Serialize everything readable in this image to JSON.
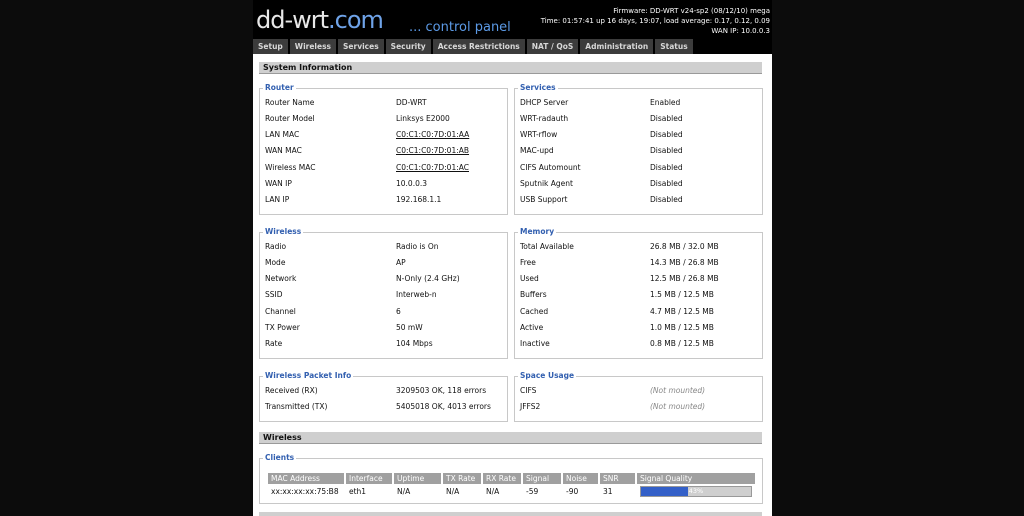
{
  "header": {
    "logo_main": "dd-wrt",
    "logo_suffix": ".com",
    "tagline": "... control panel",
    "firmware": "Firmware: DD-WRT v24-sp2 (08/12/10) mega",
    "time": "Time: 01:57:41 up 16 days, 19:07, load average: 0.17, 0.12, 0.09",
    "wan_ip": "WAN IP: 10.0.0.3"
  },
  "nav": [
    "Setup",
    "Wireless",
    "Services",
    "Security",
    "Access Restrictions",
    "NAT / QoS",
    "Administration",
    "Status"
  ],
  "section1_title": "System Information",
  "router": {
    "title": "Router",
    "rows": [
      {
        "k": "Router Name",
        "v": "DD-WRT"
      },
      {
        "k": "Router Model",
        "v": "Linksys E2000"
      },
      {
        "k": "LAN MAC",
        "v": "C0:C1:C0:7D:01:AA"
      },
      {
        "k": "WAN MAC",
        "v": "C0:C1:C0:7D:01:AB"
      },
      {
        "k": "Wireless MAC",
        "v": "C0:C1:C0:7D:01:AC"
      },
      {
        "k": "WAN IP",
        "v": "10.0.0.3"
      },
      {
        "k": "LAN IP",
        "v": "192.168.1.1"
      }
    ]
  },
  "services": {
    "title": "Services",
    "rows": [
      {
        "k": "DHCP Server",
        "v": "Enabled"
      },
      {
        "k": "WRT-radauth",
        "v": "Disabled"
      },
      {
        "k": "WRT-rflow",
        "v": "Disabled"
      },
      {
        "k": "MAC-upd",
        "v": "Disabled"
      },
      {
        "k": "CIFS Automount",
        "v": "Disabled"
      },
      {
        "k": "Sputnik Agent",
        "v": "Disabled"
      },
      {
        "k": "USB Support",
        "v": "Disabled"
      }
    ]
  },
  "wireless": {
    "title": "Wireless",
    "rows": [
      {
        "k": "Radio",
        "v": "Radio is On"
      },
      {
        "k": "Mode",
        "v": "AP"
      },
      {
        "k": "Network",
        "v": "N-Only (2.4 GHz)"
      },
      {
        "k": "SSID",
        "v": "Interweb-n"
      },
      {
        "k": "Channel",
        "v": "6"
      },
      {
        "k": "TX Power",
        "v": "50 mW"
      },
      {
        "k": "Rate",
        "v": "104 Mbps"
      }
    ]
  },
  "memory": {
    "title": "Memory",
    "rows": [
      {
        "k": "Total Available",
        "v": "26.8 MB / 32.0 MB"
      },
      {
        "k": "Free",
        "v": "14.3 MB / 26.8 MB"
      },
      {
        "k": "Used",
        "v": "12.5 MB / 26.8 MB"
      },
      {
        "k": "Buffers",
        "v": "1.5 MB / 12.5 MB"
      },
      {
        "k": "Cached",
        "v": "4.7 MB / 12.5 MB"
      },
      {
        "k": "Active",
        "v": "1.0 MB / 12.5 MB"
      },
      {
        "k": "Inactive",
        "v": "0.8 MB / 12.5 MB"
      }
    ]
  },
  "packet": {
    "title": "Wireless Packet Info",
    "rows": [
      {
        "k": "Received (RX)",
        "v": "3209503 OK, 118 errors"
      },
      {
        "k": "Transmitted (TX)",
        "v": "5405018 OK, 4013 errors"
      }
    ]
  },
  "space": {
    "title": "Space Usage",
    "rows": [
      {
        "k": "CIFS",
        "v": "(Not mounted)"
      },
      {
        "k": "JFFS2",
        "v": "(Not mounted)"
      }
    ]
  },
  "section2_title": "Wireless",
  "clients": {
    "title": "Clients",
    "headers": [
      "MAC Address",
      "Interface",
      "Uptime",
      "TX Rate",
      "RX Rate",
      "Signal",
      "Noise",
      "SNR",
      "Signal Quality"
    ],
    "row": {
      "mac": "xx:xx:xx:xx:75:B8",
      "iface": "eth1",
      "uptime": "N/A",
      "tx": "N/A",
      "rx": "N/A",
      "signal": "-59",
      "noise": "-90",
      "snr": "31",
      "quality_label": "43%",
      "quality_pct": 43
    }
  },
  "colors": {
    "accent": "#3360b0",
    "bar_fill": "#3460c8"
  }
}
